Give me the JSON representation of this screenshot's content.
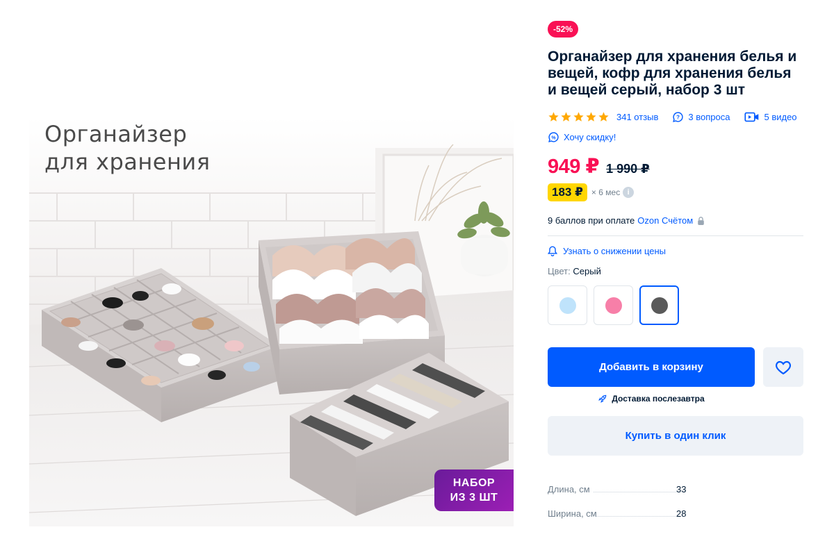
{
  "image": {
    "caption_line1": "Органайзер",
    "caption_line2": "для хранения",
    "badge_line1": "НАБОР",
    "badge_line2": "ИЗ 3 ШТ"
  },
  "product": {
    "discount_badge": "-52%",
    "title": "Органайзер для хранения белья и вещей, кофр для хранения белья и вещей серый, набор 3 шт",
    "rating_stars": 5,
    "reviews": "341 отзыв",
    "questions": "3 вопроса",
    "videos": "5 видео",
    "want_discount": "Хочу скидку!",
    "price_now": "949 ₽",
    "price_old": "1 990 ₽",
    "installment_amount": "183 ₽",
    "installment_term": "× 6 мес",
    "points_text": "9 баллов при оплате",
    "points_link": "Ozon Счётом",
    "notify_price": "Узнать о снижении цены",
    "color_label": "Цвет:",
    "color_value": "Серый",
    "swatches": [
      {
        "color": "#bfe3fb",
        "selected": false
      },
      {
        "color": "#f77fa8",
        "selected": false
      },
      {
        "color": "#5a5a5a",
        "selected": true
      }
    ],
    "add_to_cart": "Добавить в корзину",
    "delivery": "Доставка послезавтра",
    "buy_one_click": "Купить в один клик",
    "specs": [
      {
        "key": "Длина, см",
        "value": "33"
      },
      {
        "key": "Ширина, см",
        "value": "28"
      }
    ]
  },
  "colors": {
    "accent_blue": "#005bff",
    "sale_red": "#f91155",
    "installment_yellow": "#ffd600",
    "star_gold": "#ffa800"
  }
}
